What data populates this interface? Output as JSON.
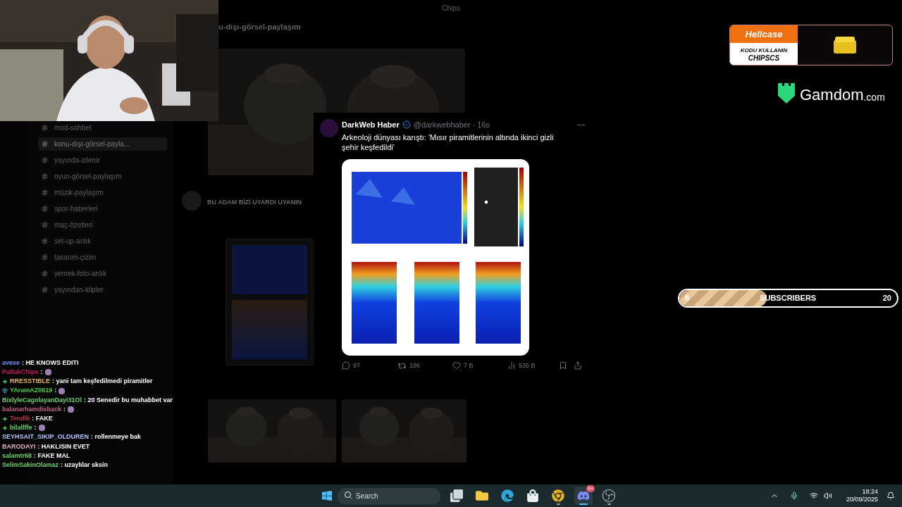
{
  "window": {
    "title": "Chips"
  },
  "discord": {
    "channel_header": "u-dışı-görsel-paylaşım",
    "channels": [
      {
        "name": "mod-sohbet",
        "selected": false
      },
      {
        "name": "konu-dışı-görsel-payla...",
        "selected": true
      },
      {
        "name": "yayında-izlenir",
        "selected": false
      },
      {
        "name": "oyun-görsel-paylaşım",
        "selected": false
      },
      {
        "name": "müzik-paylaşım",
        "selected": false
      },
      {
        "name": "spor-haberleri",
        "selected": false
      },
      {
        "name": "maç-özetleri",
        "selected": false
      },
      {
        "name": "set-up-anlık",
        "selected": false
      },
      {
        "name": "tasarım-çizim",
        "selected": false
      },
      {
        "name": "yemek-foto-anlık",
        "selected": false
      },
      {
        "name": "yayından-klipler",
        "selected": false
      }
    ],
    "message": "BU ADAM BİZİ UYARDI UYANIN"
  },
  "tweet": {
    "author": "DarkWeb Haber",
    "verified": true,
    "meta": "@darkwebhaber · 16s",
    "text": "Arkeoloji dünyası karıştı: 'Mısır piramitlerinin altında ikinci gizli şehir keşfedildi'",
    "replies": "97",
    "reposts": "196",
    "likes": "7 B",
    "views": "535 B"
  },
  "chat": [
    {
      "user": "avexe",
      "color": "#6a8cff",
      "kind": "plain",
      "text": ": HE KNOWS EDITI",
      "emote": false
    },
    {
      "user": "PatlakChips",
      "color": "#c2185b",
      "kind": "plain",
      "text": ":",
      "emote": true
    },
    {
      "user": "RRESSTIBLE",
      "color": "#e6b35a",
      "kind": "plus",
      "text": ": yani tam keşfedilmedi piramitler",
      "emote": false
    },
    {
      "user": "YAramAZ0619",
      "color": "#3fd13f",
      "kind": "gem",
      "text": ":",
      "emote": true
    },
    {
      "user": "BixlyleCagolayanDayi31Ol",
      "color": "#6ad36a",
      "kind": "plain",
      "text": ": 20 Senedir bu muhabbet var",
      "emote": false
    },
    {
      "user": "balanarhamdisback",
      "color": "#c2607f",
      "kind": "plain",
      "text": ":",
      "emote": true
    },
    {
      "user": "Tendlli",
      "color": "#c0304a",
      "kind": "plus",
      "text": ": FAKE",
      "emote": false
    },
    {
      "user": "bilallffe",
      "color": "#6ad36a",
      "kind": "plus",
      "text": ":",
      "emote": true
    },
    {
      "user": "SEYHSAIT_SIKIP_OLDUREN",
      "color": "#b0c4ff",
      "kind": "plain",
      "text": ": rollenmeye bak",
      "emote": false
    },
    {
      "user": "BARODAYI",
      "color": "#e0b0c0",
      "kind": "plain",
      "text": ": HAKLISIN EVET",
      "emote": false
    },
    {
      "user": "salamtr68",
      "color": "#6ad36a",
      "kind": "plain",
      "text": ": FAKE MAL",
      "emote": false
    },
    {
      "user": "SelimSakinOlamaz",
      "color": "#6ad36a",
      "kind": "plain",
      "text": ": uzaylılar sksin",
      "emote": false
    }
  ],
  "hellcase": {
    "brand": "Hellcase",
    "prompt": "KODU KULLANIN",
    "code": "CHIPSCS"
  },
  "gamdom": {
    "brand": "Gamdom",
    "suffix": ".com"
  },
  "subscribers": {
    "current": "8",
    "label": "SUBSCRIBERS",
    "goal": "20",
    "level": 0.4
  },
  "taskbar": {
    "search_placeholder": "Search",
    "apps": [
      {
        "kind": "taskview",
        "running": false,
        "active": false
      },
      {
        "kind": "files",
        "running": false,
        "active": false
      },
      {
        "kind": "edge",
        "running": false,
        "active": false
      },
      {
        "kind": "store",
        "running": false,
        "active": false
      },
      {
        "kind": "chrome",
        "running": true,
        "active": false
      },
      {
        "kind": "discord",
        "running": true,
        "active": true,
        "badge": "9+"
      },
      {
        "kind": "obs",
        "running": true,
        "active": false
      }
    ],
    "time": "18:24",
    "date": "20/09/2025"
  }
}
